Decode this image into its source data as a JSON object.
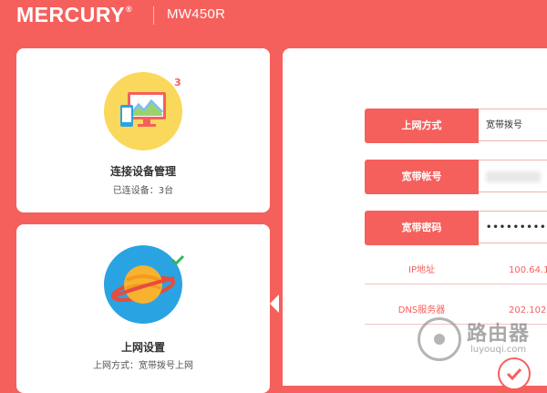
{
  "header": {
    "brand": "MERCURY",
    "brand_mark": "®",
    "model": "MW450R"
  },
  "cards": {
    "devices": {
      "icon": "monitor-phone-icon",
      "badge": "3",
      "title": "连接设备管理",
      "subtitle": "已连设备：3台"
    },
    "internet": {
      "icon": "planet-icon",
      "status_icon": "check-icon",
      "title": "上网设置",
      "subtitle": "上网方式：宽带拨号上网"
    }
  },
  "form": {
    "rows": [
      {
        "label": "上网方式",
        "value": "宽带拨号"
      },
      {
        "label": "宽带帐号",
        "value": ""
      },
      {
        "label": "宽带密码",
        "value": "••••••••••"
      }
    ],
    "info": [
      {
        "label": "IP地址",
        "value": "100.64.1"
      },
      {
        "label": "DNS服务器",
        "value": "202.102."
      }
    ]
  },
  "watermark": {
    "text": "路由器",
    "url": "luyouqi.com"
  },
  "colors": {
    "accent": "#f5605c",
    "card_bg": "#ffffff",
    "yellow": "#fad85c",
    "blue": "#2aa3e2"
  }
}
